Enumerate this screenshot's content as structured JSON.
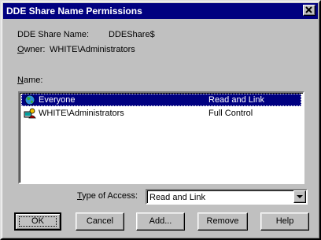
{
  "window": {
    "title": "DDE Share Name Permissions"
  },
  "share": {
    "label": "DDE Share Name:",
    "value": "DDEShare$"
  },
  "owner": {
    "label": "Owner:",
    "value": "WHITE\\Administrators"
  },
  "name_label": "Name:",
  "list": [
    {
      "name": "Everyone",
      "access": "Read and Link",
      "icon": "group-globe-icon",
      "selected": true
    },
    {
      "name": "WHITE\\Administrators",
      "access": "Full Control",
      "icon": "user-group-icon",
      "selected": false
    }
  ],
  "access": {
    "label": "Type of Access:",
    "value": "Read and Link"
  },
  "buttons": {
    "ok": "OK",
    "cancel": "Cancel",
    "add": "Add...",
    "remove": "Remove",
    "help": "Help"
  },
  "colors": {
    "titlebar": "#000080",
    "face": "#c0c0c0",
    "selection": "#000080"
  }
}
